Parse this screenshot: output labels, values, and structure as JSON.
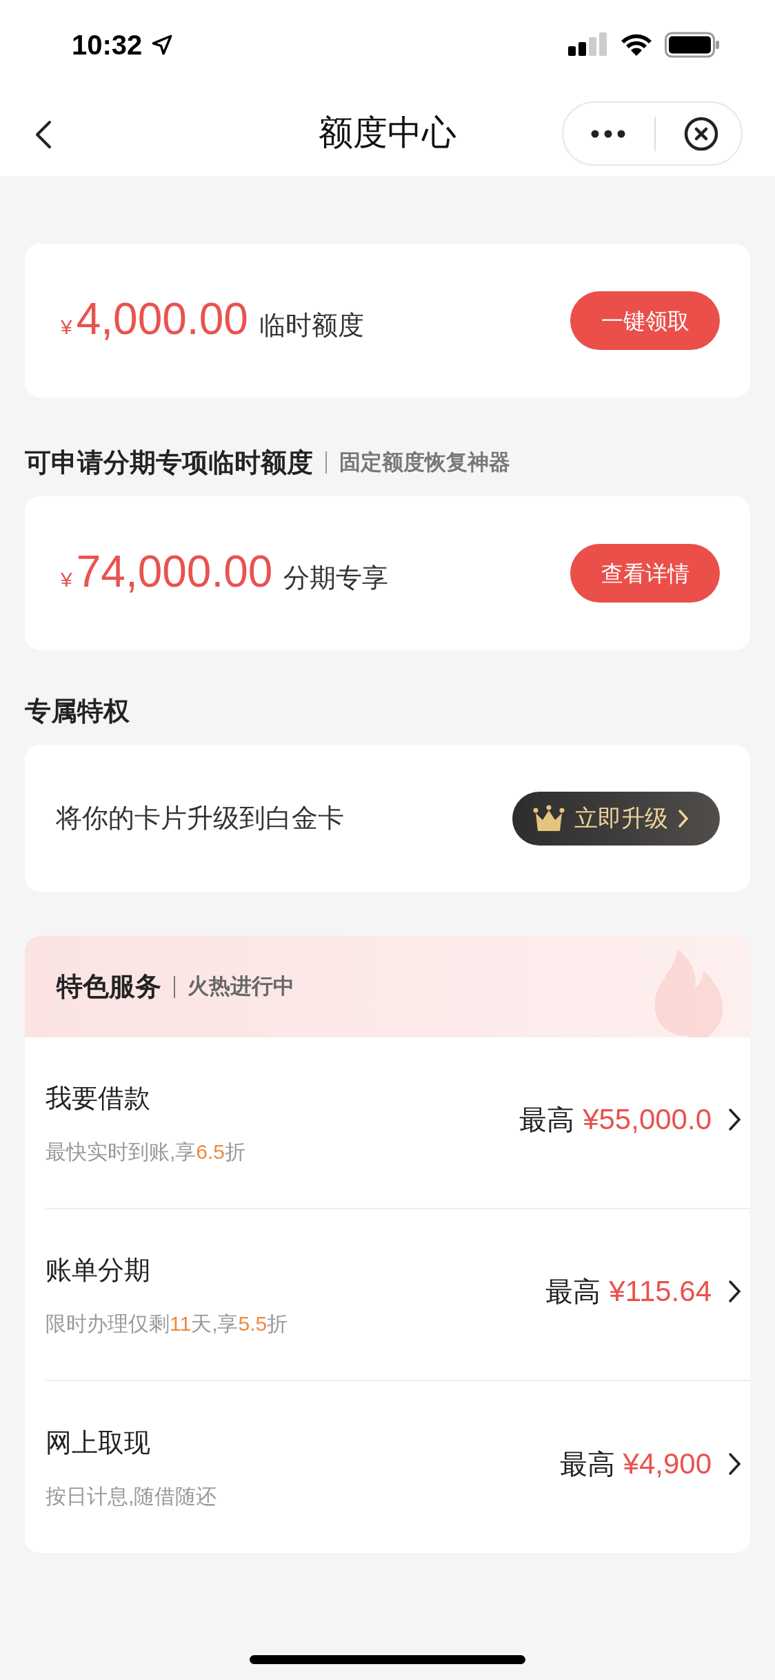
{
  "status_bar": {
    "time": "10:32"
  },
  "nav": {
    "title": "额度中心"
  },
  "sections": [
    {
      "card": {
        "kind": "amount",
        "currency": "¥",
        "amount": "4,000.00",
        "label": "临时额度",
        "button": "一键领取"
      }
    },
    {
      "heading": "可申请分期专项临时额度",
      "subheading": "固定额度恢复神器",
      "card": {
        "kind": "amount",
        "currency": "¥",
        "amount": "74,000.00",
        "label": "分期专享",
        "button": "查看详情"
      }
    },
    {
      "heading": "专属特权",
      "card": {
        "kind": "upgrade",
        "text": "将你的卡片升级到白金卡",
        "button": "立即升级"
      }
    }
  ],
  "services": {
    "title": "特色服务",
    "subtitle": "火热进行中",
    "items": [
      {
        "title": "我要借款",
        "prefix": "最高",
        "amount": "¥55,000.0",
        "sub": [
          {
            "text": "最快实时到账,享",
            "highlight": false
          },
          {
            "text": "6.5",
            "highlight": true
          },
          {
            "text": "折",
            "highlight": false
          }
        ]
      },
      {
        "title": "账单分期",
        "prefix": "最高",
        "amount": "¥115.64",
        "sub": [
          {
            "text": "限时办理仅剩",
            "highlight": false
          },
          {
            "text": "11",
            "highlight": true
          },
          {
            "text": "天,享",
            "highlight": false
          },
          {
            "text": "5.5",
            "highlight": true
          },
          {
            "text": "折",
            "highlight": false
          }
        ]
      },
      {
        "title": "网上取现",
        "prefix": "最高",
        "amount": "¥4,900",
        "sub": [
          {
            "text": "按日计息,随借随还",
            "highlight": false
          }
        ]
      }
    ]
  }
}
